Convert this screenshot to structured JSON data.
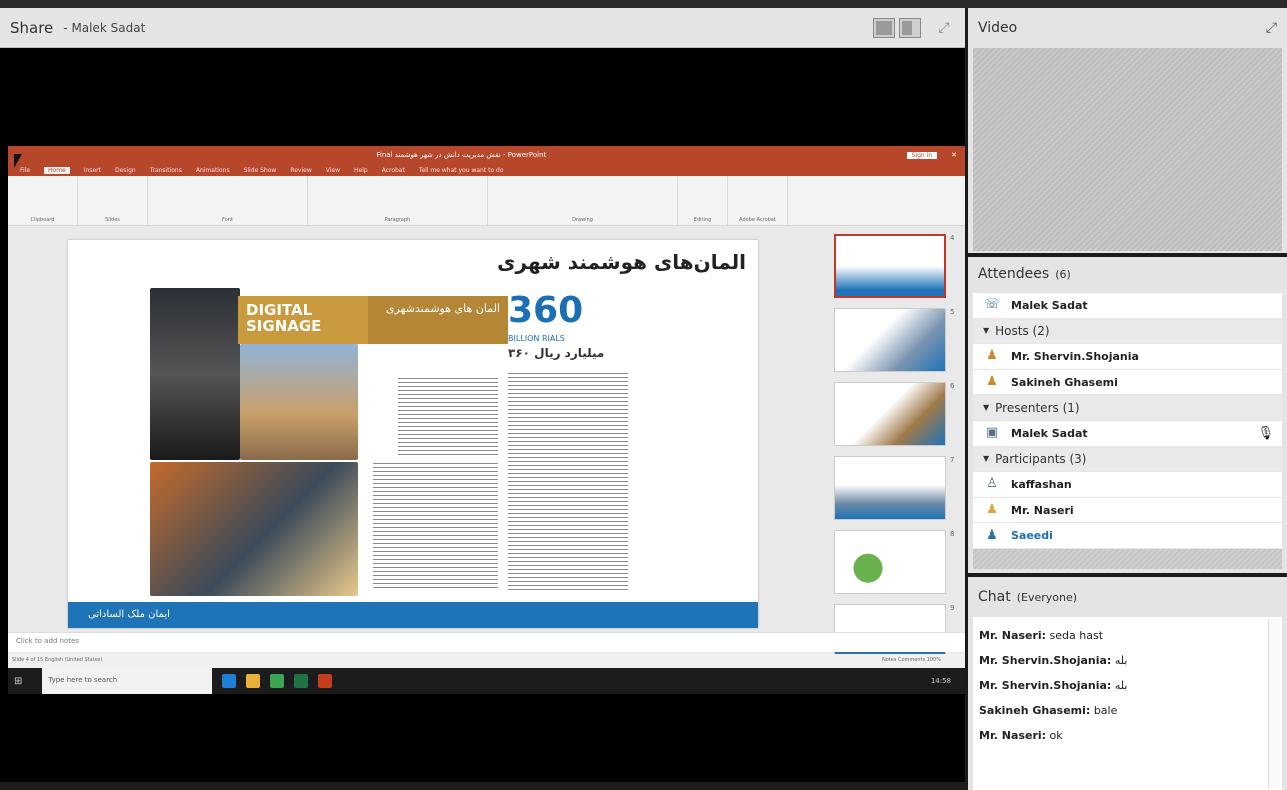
{
  "share": {
    "title": "Share",
    "presenter": "- Malek Sadat"
  },
  "ppt": {
    "title_bar": "Final نقش مدیریت دانش در شهر هوشمند - PowerPoint",
    "signin": "Sign in",
    "tabs": [
      "File",
      "Home",
      "Insert",
      "Design",
      "Transitions",
      "Animations",
      "Slide Show",
      "Review",
      "View",
      "Help",
      "Acrobat",
      "Tell me what you want to do"
    ],
    "ribbon_groups": [
      "Clipboard",
      "Slides",
      "Font",
      "Paragraph",
      "Drawing",
      "Editing",
      "Adobe Acrobat"
    ],
    "slide": {
      "heading": "المان‌های هوشمند شهری",
      "digital": "DIGITAL SIGNAGE",
      "fa_label": "المان های هوشمندشهری",
      "big_number": "360",
      "billion": "BILLION RIALS",
      "fa_amount": "۳۶۰ میلیارد ریال",
      "footer": "ایمان ملک الساداتی"
    },
    "thumb_numbers": [
      "4",
      "5",
      "6",
      "7",
      "8",
      "9"
    ],
    "notes": "Click to add notes",
    "status_left": "Slide 4 of 15    English (United States)",
    "status_right": "Notes   Comments   100%",
    "taskbar_search": "Type here to search",
    "clock": "14:58"
  },
  "video": {
    "title": "Video"
  },
  "attendees": {
    "title": "Attendees",
    "count": "(6)",
    "host_line": "Malek Sadat",
    "hosts_label": "Hosts (2)",
    "hosts": [
      "Mr. Shervin.Shojania",
      "Sakineh Ghasemi"
    ],
    "presenters_label": "Presenters (1)",
    "presenters": [
      "Malek Sadat"
    ],
    "participants_label": "Participants (3)",
    "participants": [
      "kaffashan",
      "Mr. Naseri",
      "Saeedi"
    ]
  },
  "chat": {
    "title": "Chat",
    "scope": "(Everyone)",
    "messages": [
      {
        "who": "Mr. Naseri:",
        "text": "seda hast"
      },
      {
        "who": "Mr. Shervin.Shojania:",
        "text": "بله"
      },
      {
        "who": "Mr. Shervin.Shojania:",
        "text": "بله"
      },
      {
        "who": "Sakineh Ghasemi:",
        "text": "bale"
      },
      {
        "who": "Mr. Naseri:",
        "text": "ok"
      }
    ]
  }
}
